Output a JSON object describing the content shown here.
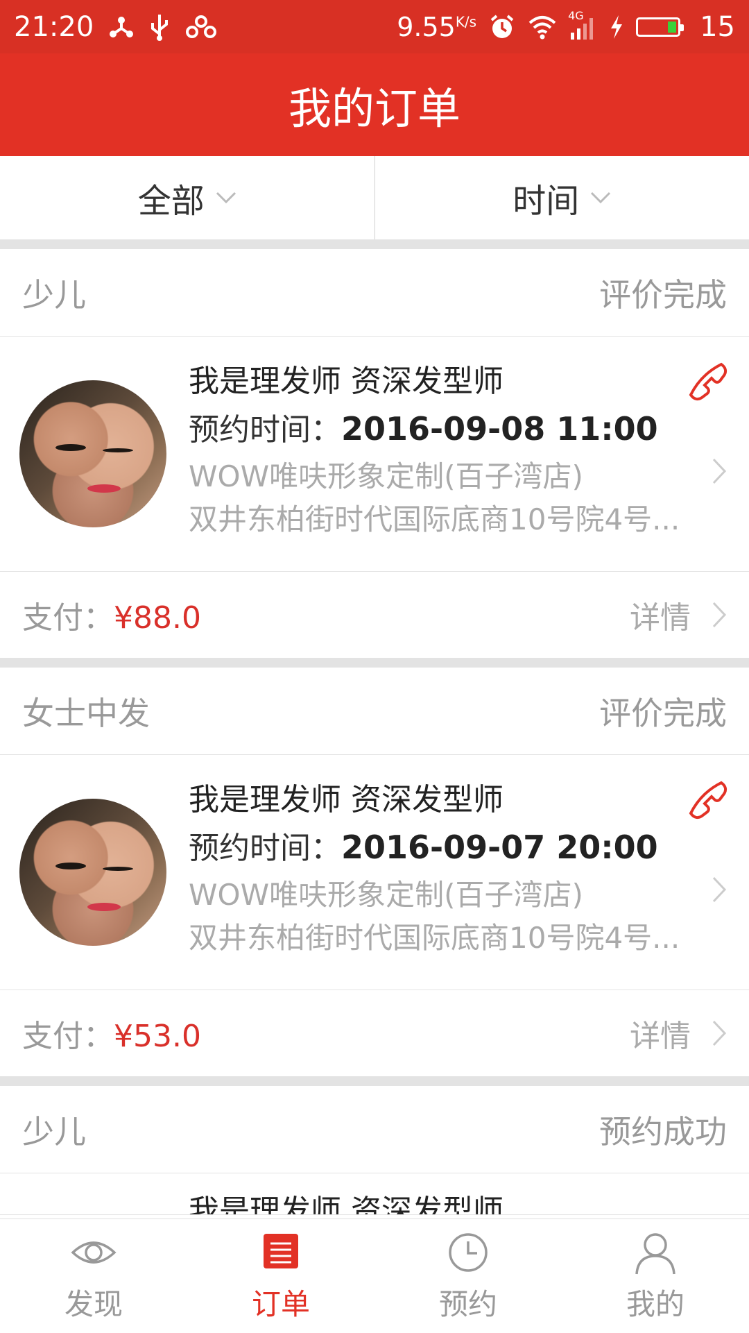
{
  "status_bar": {
    "time": "21:20",
    "speed": "9.55",
    "speed_unit": "K/s",
    "network": "4G",
    "battery_level": "15"
  },
  "app_bar": {
    "title": "我的订单"
  },
  "filters": {
    "category": "全部",
    "sort": "时间"
  },
  "colors": {
    "accent": "#e23125",
    "price": "#d9302a"
  },
  "orders": [
    {
      "service": "少儿",
      "status": "评价完成",
      "stylist": "我是理发师  资深发型师",
      "time_label": "预约时间：",
      "time_value": "2016-09-08 11:00",
      "shop": "WOW唯呋形象定制(百子湾店)",
      "address": "双井东柏街时代国际底商10号院4号...",
      "pay_label": "支付：",
      "pay_value": "¥88.0",
      "detail_label": "详情"
    },
    {
      "service": "女士中发",
      "status": "评价完成",
      "stylist": "我是理发师  资深发型师",
      "time_label": "预约时间：",
      "time_value": "2016-09-07 20:00",
      "shop": "WOW唯呋形象定制(百子湾店)",
      "address": "双井东柏街时代国际底商10号院4号...",
      "pay_label": "支付：",
      "pay_value": "¥53.0",
      "detail_label": "详情"
    },
    {
      "service": "少儿",
      "status": "预约成功",
      "stylist": "我是理发师  资深发型师"
    }
  ],
  "bottom_nav": [
    {
      "label": "发现",
      "icon": "eye-icon"
    },
    {
      "label": "订单",
      "icon": "order-list-icon",
      "active": true
    },
    {
      "label": "预约",
      "icon": "clock-icon"
    },
    {
      "label": "我的",
      "icon": "person-icon"
    }
  ]
}
